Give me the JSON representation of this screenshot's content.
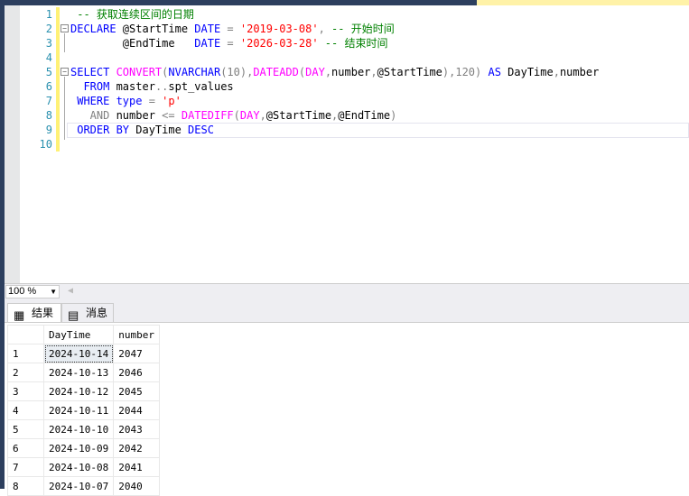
{
  "editor": {
    "line_numbers": [
      "1",
      "2",
      "3",
      "4",
      "5",
      "6",
      "7",
      "8",
      "9",
      "10"
    ],
    "lines": [
      [
        [
          "cm",
          " -- 获取连续区间的日期"
        ]
      ],
      [
        [
          "kw",
          "DECLARE"
        ],
        [
          "tx",
          " @StartTime "
        ],
        [
          "kw",
          "DATE"
        ],
        [
          "gr",
          " = "
        ],
        [
          "str",
          "'2019-03-08'"
        ],
        [
          "gr",
          ","
        ],
        [
          "cm",
          " -- 开始时间"
        ]
      ],
      [
        [
          "tx",
          "        @EndTime   "
        ],
        [
          "kw",
          "DATE"
        ],
        [
          "gr",
          " = "
        ],
        [
          "str",
          "'2026-03-28'"
        ],
        [
          "cm",
          " -- 结束时间"
        ]
      ],
      [],
      [
        [
          "kw",
          "SELECT "
        ],
        [
          "fn",
          "CONVERT"
        ],
        [
          "gr",
          "("
        ],
        [
          "kw",
          "NVARCHAR"
        ],
        [
          "gr",
          "(10),"
        ],
        [
          "fn",
          "DATEADD"
        ],
        [
          "gr",
          "("
        ],
        [
          "fn",
          "DAY"
        ],
        [
          "gr",
          ","
        ],
        [
          "tx",
          "number"
        ],
        [
          "gr",
          ","
        ],
        [
          "tx",
          "@StartTime"
        ],
        [
          "gr",
          "),120) "
        ],
        [
          "kw",
          "AS"
        ],
        [
          "tx",
          " DayTime"
        ],
        [
          "gr",
          ","
        ],
        [
          "tx",
          "number"
        ]
      ],
      [
        [
          "kw",
          "  FROM "
        ],
        [
          "tx",
          "master"
        ],
        [
          "gr",
          ".."
        ],
        [
          "tx",
          "spt_values"
        ]
      ],
      [
        [
          "kw",
          " WHERE "
        ],
        [
          "kw",
          "type"
        ],
        [
          "gr",
          " = "
        ],
        [
          "str",
          "'p'"
        ]
      ],
      [
        [
          "gr",
          "   AND "
        ],
        [
          "tx",
          "number "
        ],
        [
          "gr",
          "<= "
        ],
        [
          "fn",
          "DATEDIFF"
        ],
        [
          "gr",
          "("
        ],
        [
          "fn",
          "DAY"
        ],
        [
          "gr",
          ","
        ],
        [
          "tx",
          "@StartTime"
        ],
        [
          "gr",
          ","
        ],
        [
          "tx",
          "@EndTime"
        ],
        [
          "gr",
          ")"
        ]
      ],
      [
        [
          "kw",
          " ORDER BY "
        ],
        [
          "tx",
          "DayTime "
        ],
        [
          "kw",
          "DESC"
        ]
      ],
      []
    ]
  },
  "zoom": {
    "value": "100 %"
  },
  "results": {
    "tabs": [
      {
        "label": "结果",
        "icon": "grid-icon"
      },
      {
        "label": "消息",
        "icon": "messages-icon"
      }
    ],
    "columns": [
      "DayTime",
      "number"
    ],
    "rows": [
      [
        "1",
        "2024-10-14",
        "2047"
      ],
      [
        "2",
        "2024-10-13",
        "2046"
      ],
      [
        "3",
        "2024-10-12",
        "2045"
      ],
      [
        "4",
        "2024-10-11",
        "2044"
      ],
      [
        "5",
        "2024-10-10",
        "2043"
      ],
      [
        "6",
        "2024-10-09",
        "2042"
      ],
      [
        "7",
        "2024-10-08",
        "2041"
      ],
      [
        "8",
        "2024-10-07",
        "2040"
      ]
    ]
  }
}
